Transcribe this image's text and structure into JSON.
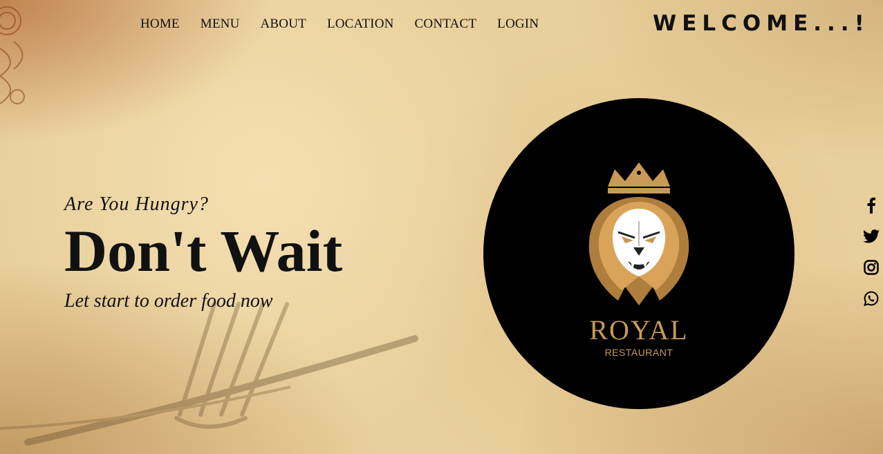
{
  "nav": {
    "items": [
      {
        "label": "HOME"
      },
      {
        "label": "MENU"
      },
      {
        "label": "ABOUT"
      },
      {
        "label": "LOCATION"
      },
      {
        "label": "CONTACT"
      },
      {
        "label": "LOGIN"
      }
    ]
  },
  "header": {
    "welcome": "WELCOME...!"
  },
  "hero": {
    "subtitle": "Are You Hungry?",
    "headline": "Don't Wait",
    "tagline": "Let start to order food now"
  },
  "logo": {
    "name": "ROYAL",
    "subname": "RESTAURANT"
  },
  "social": {
    "icons": [
      "facebook-icon",
      "twitter-icon",
      "instagram-icon",
      "whatsapp-icon"
    ]
  },
  "colors": {
    "background": "#e9cf9b",
    "text": "#111111",
    "logo_gold": "#c89a55",
    "logo_circle": "#000000"
  }
}
